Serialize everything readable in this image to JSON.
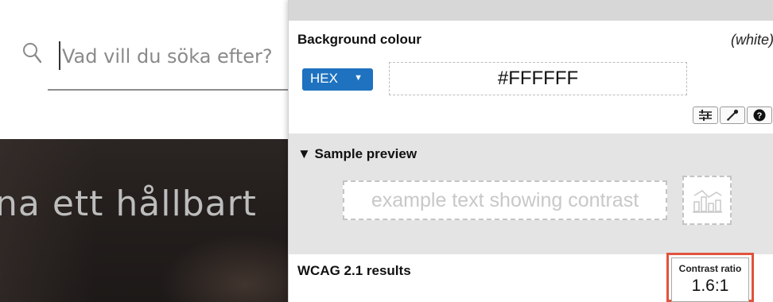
{
  "search": {
    "placeholder": "Vad vill du söka efter?",
    "value": ""
  },
  "hero": {
    "heading": "na ett hållbart"
  },
  "contrast_panel": {
    "background_label": "Background colour",
    "colour_name": "(white)",
    "format_select": "HEX",
    "hex_value": "#FFFFFF",
    "tools": [
      "sliders-icon",
      "eyedropper-icon",
      "help-icon"
    ],
    "preview": {
      "toggle_label": "▼ Sample preview",
      "sample_text": "example text showing contrast",
      "chart_icon": "chart-preview-icon"
    },
    "results": {
      "label": "WCAG 2.1 results",
      "ratio_title": "Contrast ratio",
      "ratio_value": "1.6:1"
    }
  },
  "colors": {
    "accent": "#1e72c0",
    "highlight": "#e0533d",
    "preview_bg": "#e4e4e4",
    "hero_bg": "#241f1d"
  }
}
